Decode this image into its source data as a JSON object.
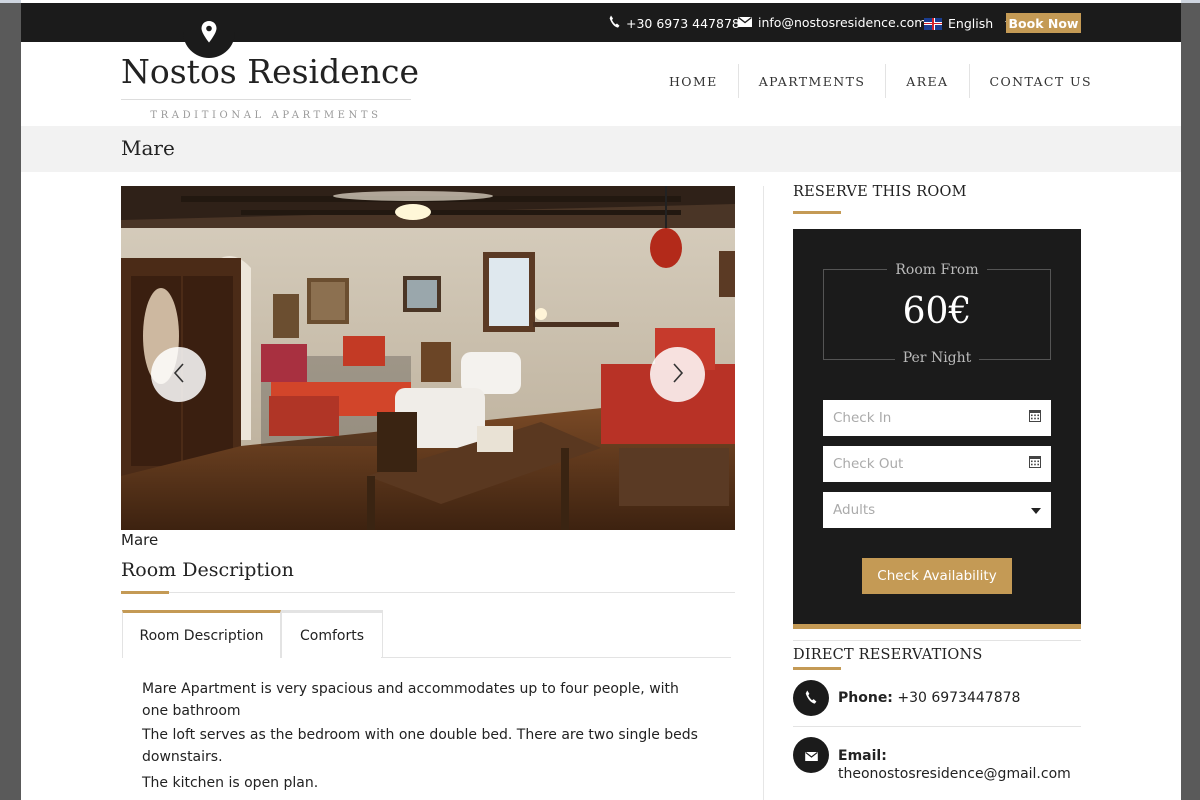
{
  "topbar": {
    "phone": "+30 6973 447878",
    "email": "info@nostosresidence.com",
    "language": "English",
    "book_now": "Book Now"
  },
  "header": {
    "logo_title": "Nostos Residence",
    "logo_subtitle": "TRADITIONAL APARTMENTS",
    "nav": [
      "HOME",
      "APARTMENTS",
      "AREA",
      "CONTACT US"
    ]
  },
  "page": {
    "title": "Mare"
  },
  "gallery": {
    "caption": "Mare",
    "prev_icon": "chevron-left-icon",
    "next_icon": "chevron-right-icon"
  },
  "room": {
    "section_heading": "Room Description",
    "tabs": [
      "Room Description",
      "Comforts"
    ],
    "paragraphs": [
      "Mare Apartment is very spacious and accommodates up to four people, with one bathroom",
      "The loft serves as the bedroom with one double bed. There are two single beds downstairs.",
      "The kitchen is open plan."
    ]
  },
  "reserve": {
    "heading": "RESERVE THIS ROOM",
    "room_from": "Room From",
    "price": "60€",
    "per_night": "Per Night",
    "check_in_placeholder": "Check In",
    "check_out_placeholder": "Check Out",
    "adults_placeholder": "Adults",
    "check_availability": "Check Availability"
  },
  "direct": {
    "heading": "DIRECT RESERVATIONS",
    "phone_label": "Phone:",
    "phone_value": "+30 6973447878",
    "email_label": "Email:",
    "email_value": "theonostosresidence@gmail.com"
  },
  "colors": {
    "accent": "#c49a55",
    "dark": "#1b1b1b"
  }
}
